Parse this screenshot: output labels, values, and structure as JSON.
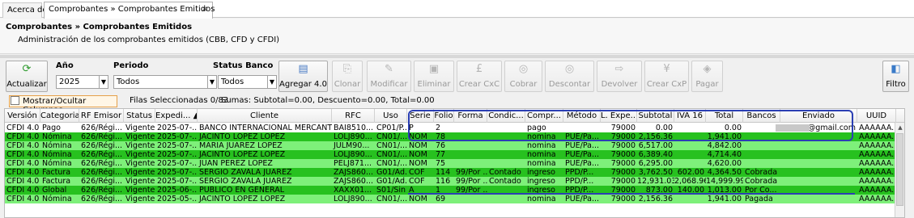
{
  "tabs": [
    {
      "label": "Acerca de"
    },
    {
      "label": "Comprobantes » Comprobantes Emitidos",
      "close": "×"
    }
  ],
  "header": {
    "title": "Comprobantes » Comprobantes Emitidos",
    "subtitle": "Administración de los comprobantes emitidos (CBB, CFD y CFDI)"
  },
  "toolbar": {
    "actualizar": "Actualizar",
    "ano_label": "Año",
    "ano_value": "2025",
    "periodo_label": "Periodo",
    "periodo_value": "Todos",
    "status_label": "Status Banco",
    "status_value": "Todos",
    "agregar": "Agregar 4.0",
    "clonar": "Clonar",
    "modificar": "Modificar",
    "eliminar": "Eliminar",
    "crear_cxc": "Crear CxC",
    "cobrar": "Cobrar",
    "descontar": "Descontar",
    "devolver": "Devolver",
    "crear_cxp": "Crear CxP",
    "pagar": "Pagar",
    "filtro": "Filtro"
  },
  "statusbar": {
    "mostrar": "Mostrar/Ocultar Columnas",
    "filas": "Filas Seleccionadas  0/83",
    "sumas": "Sumas:  Subtotal=0.00, Descuento=0.00, Total=0.00"
  },
  "columns": [
    "Versión",
    "Categoria",
    "RF Emisor",
    "Status",
    "Expedi... ▲",
    "Cliente",
    "RFC",
    "Uso",
    "Serie",
    "Folio",
    "Forma",
    "Condic...",
    "Compr...",
    "Método",
    "L. Expe...",
    "Subtotal",
    "IVA 16",
    "Total",
    "Bancos",
    "Enviado",
    "UUID"
  ],
  "rows": [
    {
      "version": "CFDI 4.0",
      "categoria": "Pago",
      "rf": "626/Régi...",
      "status": "Vigente",
      "exp": "2025-07-...",
      "cliente": "BANCO INTERNACIONAL MERCANTIL",
      "rfc": "BAI8510...",
      "uso": "CP01/P...",
      "serie": "P",
      "folio": "2",
      "forma": "",
      "cond": "",
      "compr": "pago",
      "metodo": "",
      "lexp": "79000",
      "subtotal": "0.00",
      "iva": "",
      "total": "0.00",
      "bancos": "",
      "enviado": "@gmail.com",
      "uuid": "AAAAAA...",
      "color": "#ffffff"
    },
    {
      "version": "CFDI 4.0",
      "categoria": "Nómina",
      "rf": "626/Régi...",
      "status": "Vigente",
      "exp": "2025-07-...",
      "cliente": "JACINTO LOPEZ LOPEZ",
      "rfc": "LOLJ890...",
      "uso": "CN01/...",
      "serie": "NOM",
      "folio": "78",
      "forma": "",
      "cond": "",
      "compr": "nomina",
      "metodo": "PUE/Pa...",
      "lexp": "79000",
      "subtotal": "2,156.36",
      "iva": "",
      "total": "1,941.00",
      "bancos": "",
      "enviado": "",
      "uuid": "AAAAAA...",
      "color": "#27c11f"
    },
    {
      "version": "CFDI 4.0",
      "categoria": "Nómina",
      "rf": "626/Régi...",
      "status": "Vigente",
      "exp": "2025-07-...",
      "cliente": "MARIA JUAREZ LOPEZ",
      "rfc": "JULM90...",
      "uso": "CN01/...",
      "serie": "NOM",
      "folio": "76",
      "forma": "",
      "cond": "",
      "compr": "nomina",
      "metodo": "PUE/Pa...",
      "lexp": "79000",
      "subtotal": "6,517.00",
      "iva": "",
      "total": "4,842.00",
      "bancos": "",
      "enviado": "",
      "uuid": "AAAAAA...",
      "color": "#7ef07a"
    },
    {
      "version": "CFDI 4.0",
      "categoria": "Nómina",
      "rf": "626/Régi...",
      "status": "Vigente",
      "exp": "2025-07-...",
      "cliente": "JACINTO LOPEZ LOPEZ",
      "rfc": "LOLJ890...",
      "uso": "CN01/...",
      "serie": "NOM",
      "folio": "77",
      "forma": "",
      "cond": "",
      "compr": "nomina",
      "metodo": "PUE/Pa...",
      "lexp": "79000",
      "subtotal": "6,389.40",
      "iva": "",
      "total": "4,714.40",
      "bancos": "",
      "enviado": "",
      "uuid": "AAAAAA...",
      "color": "#27c11f"
    },
    {
      "version": "CFDI 4.0",
      "categoria": "Nómina",
      "rf": "626/Régi...",
      "status": "Vigente",
      "exp": "2025-07-...",
      "cliente": "JUAN PEREZ LOPEZ",
      "rfc": "PELJ871...",
      "uso": "CN01/...",
      "serie": "NOM",
      "folio": "75",
      "forma": "",
      "cond": "",
      "compr": "nomina",
      "metodo": "PUE/Pa...",
      "lexp": "79000",
      "subtotal": "6,295.00",
      "iva": "",
      "total": "4,620.00",
      "bancos": "",
      "enviado": "",
      "uuid": "AAAAAA...",
      "color": "#7ef07a"
    },
    {
      "version": "CFDI 4.0",
      "categoria": "Factura",
      "rf": "626/Régi...",
      "status": "Vigente",
      "exp": "2025-07-...",
      "cliente": "SERGIO ZAVALA JUAREZ",
      "rfc": "ZAJS860...",
      "uso": "G01/Ad...",
      "serie": "COF",
      "folio": "114",
      "forma": "99/Por ...",
      "cond": "Contado",
      "compr": "ingreso",
      "metodo": "PPD/P...",
      "lexp": "79000",
      "subtotal": "3,762.50",
      "iva": "602.00",
      "total": "4,364.50",
      "bancos": "Cobrada",
      "enviado": "",
      "uuid": "AAAAAA...",
      "color": "#27c11f"
    },
    {
      "version": "CFDI 4.0",
      "categoria": "Factura",
      "rf": "626/Régi...",
      "status": "Vigente",
      "exp": "2025-07-...",
      "cliente": "SERGIO ZAVALA JUAREZ",
      "rfc": "ZAJS860...",
      "uso": "G01/Ad...",
      "serie": "COF",
      "folio": "116",
      "forma": "99/Por ...",
      "cond": "Contado",
      "compr": "ingreso",
      "metodo": "PPD/P...",
      "lexp": "79000",
      "subtotal": "12,931.03",
      "iva": "2,068.96",
      "total": "14,999.99",
      "bancos": "Cobrada",
      "enviado": "",
      "uuid": "AAAAAA...",
      "color": "#7ef07a"
    },
    {
      "version": "CFDI 4.0",
      "categoria": "Global",
      "rf": "626/Régi...",
      "status": "Vigente",
      "exp": "2025-06-...",
      "cliente": "PUBLICO EN GENERAL",
      "rfc": "XAXX01...",
      "uso": "S01/Sin ...",
      "serie": "A",
      "folio": "1",
      "forma": "99/Por ...",
      "cond": "",
      "compr": "ingreso",
      "metodo": "PPD/P...",
      "lexp": "79000",
      "subtotal": "873.00",
      "iva": "140.00",
      "total": "1,013.00",
      "bancos": "Por Co...",
      "enviado": "",
      "uuid": "AAAAAA...",
      "color": "#27c11f"
    },
    {
      "version": "CFDI 4.0",
      "categoria": "Nómina",
      "rf": "626/Régi...",
      "status": "Vigente",
      "exp": "2025-05-...",
      "cliente": "JACINTO LOPEZ LOPEZ",
      "rfc": "LOLJ890...",
      "uso": "CN01/...",
      "serie": "NOM",
      "folio": "69",
      "forma": "",
      "cond": "",
      "compr": "nomina",
      "metodo": "PUE/Pa...",
      "lexp": "79000",
      "subtotal": "2,156.36",
      "iva": "",
      "total": "1,941.00",
      "bancos": "Pagada",
      "enviado": "",
      "uuid": "AAAAAA...",
      "color": "#7ef07a"
    }
  ]
}
